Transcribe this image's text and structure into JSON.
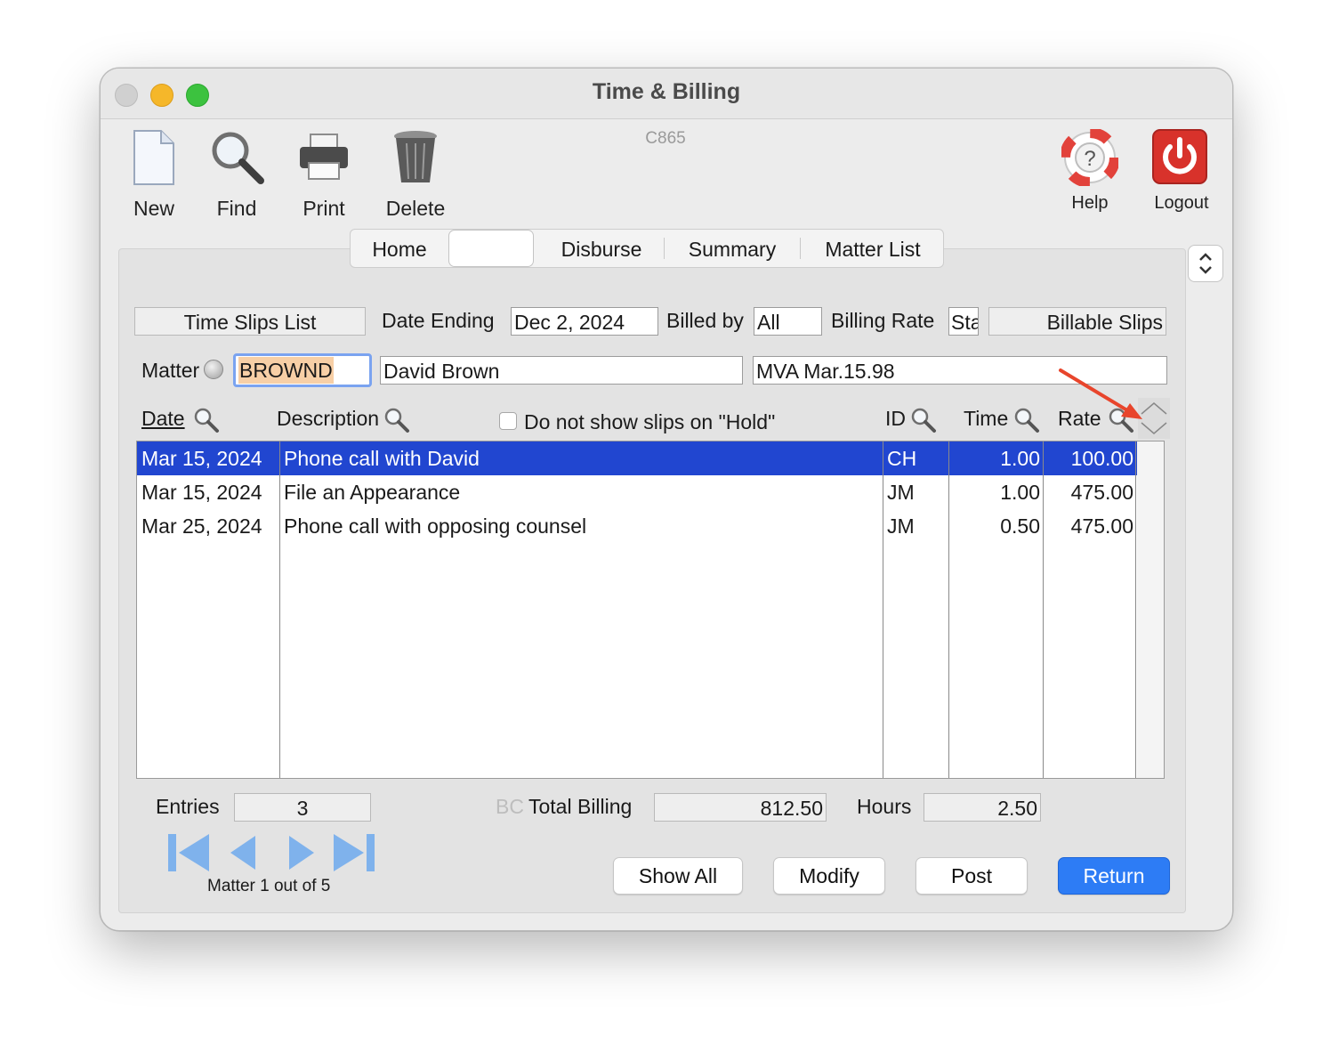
{
  "window": {
    "title": "Time & Billing",
    "code": "C865"
  },
  "toolbar": {
    "new_label": "New",
    "find_label": "Find",
    "print_label": "Print",
    "delete_label": "Delete",
    "help_label": "Help",
    "logout_label": "Logout"
  },
  "tabs": [
    "Home",
    "",
    "Disburse",
    "Summary",
    "Matter List"
  ],
  "header": {
    "list_label": "Time Slips List",
    "date_ending_label": "Date Ending",
    "date_ending_value": "Dec 2, 2024",
    "billed_by_label": "Billed by",
    "billed_by_value": "All",
    "billing_rate_label": "Billing Rate",
    "billing_rate_value": "Sta",
    "slip_filter": "Billable Slips"
  },
  "matter": {
    "label": "Matter",
    "code": "BROWND",
    "client": "David Brown",
    "description": "MVA Mar.15.98"
  },
  "columns": {
    "date": "Date",
    "description": "Description",
    "hold_checkbox_label": "Do not show slips on \"Hold\"",
    "hold_checked": false,
    "id": "ID",
    "time": "Time",
    "rate": "Rate"
  },
  "rows": [
    {
      "date": "Mar 15, 2024",
      "description": "Phone call with David",
      "id": "CH",
      "time": "1.00",
      "rate": "100.00",
      "selected": true
    },
    {
      "date": "Mar 15, 2024",
      "description": "File an Appearance",
      "id": "JM",
      "time": "1.00",
      "rate": "475.00",
      "selected": false
    },
    {
      "date": "Mar 25, 2024",
      "description": "Phone call with opposing counsel",
      "id": "JM",
      "time": "0.50",
      "rate": "475.00",
      "selected": false
    }
  ],
  "footer": {
    "entries_label": "Entries",
    "entries_value": "3",
    "bc_label": "BC",
    "total_billing_label": "Total Billing",
    "total_billing_value": "812.50",
    "hours_label": "Hours",
    "hours_value": "2.50",
    "nav_status": "Matter 1 out of 5"
  },
  "buttons": {
    "show_all": "Show All",
    "modify": "Modify",
    "post": "Post",
    "return": "Return"
  },
  "colors": {
    "selection": "#2146d0",
    "primary_button": "#2d7cf5",
    "matter_code_highlight": "#f7cfa6",
    "annotation_arrow": "#e8452c",
    "nav_arrows": "#7fb2ec"
  },
  "icons": {
    "new": "document-icon",
    "find": "magnifier-icon",
    "print": "printer-icon",
    "delete": "trash-icon",
    "help": "lifebuoy-icon",
    "logout": "power-icon"
  }
}
